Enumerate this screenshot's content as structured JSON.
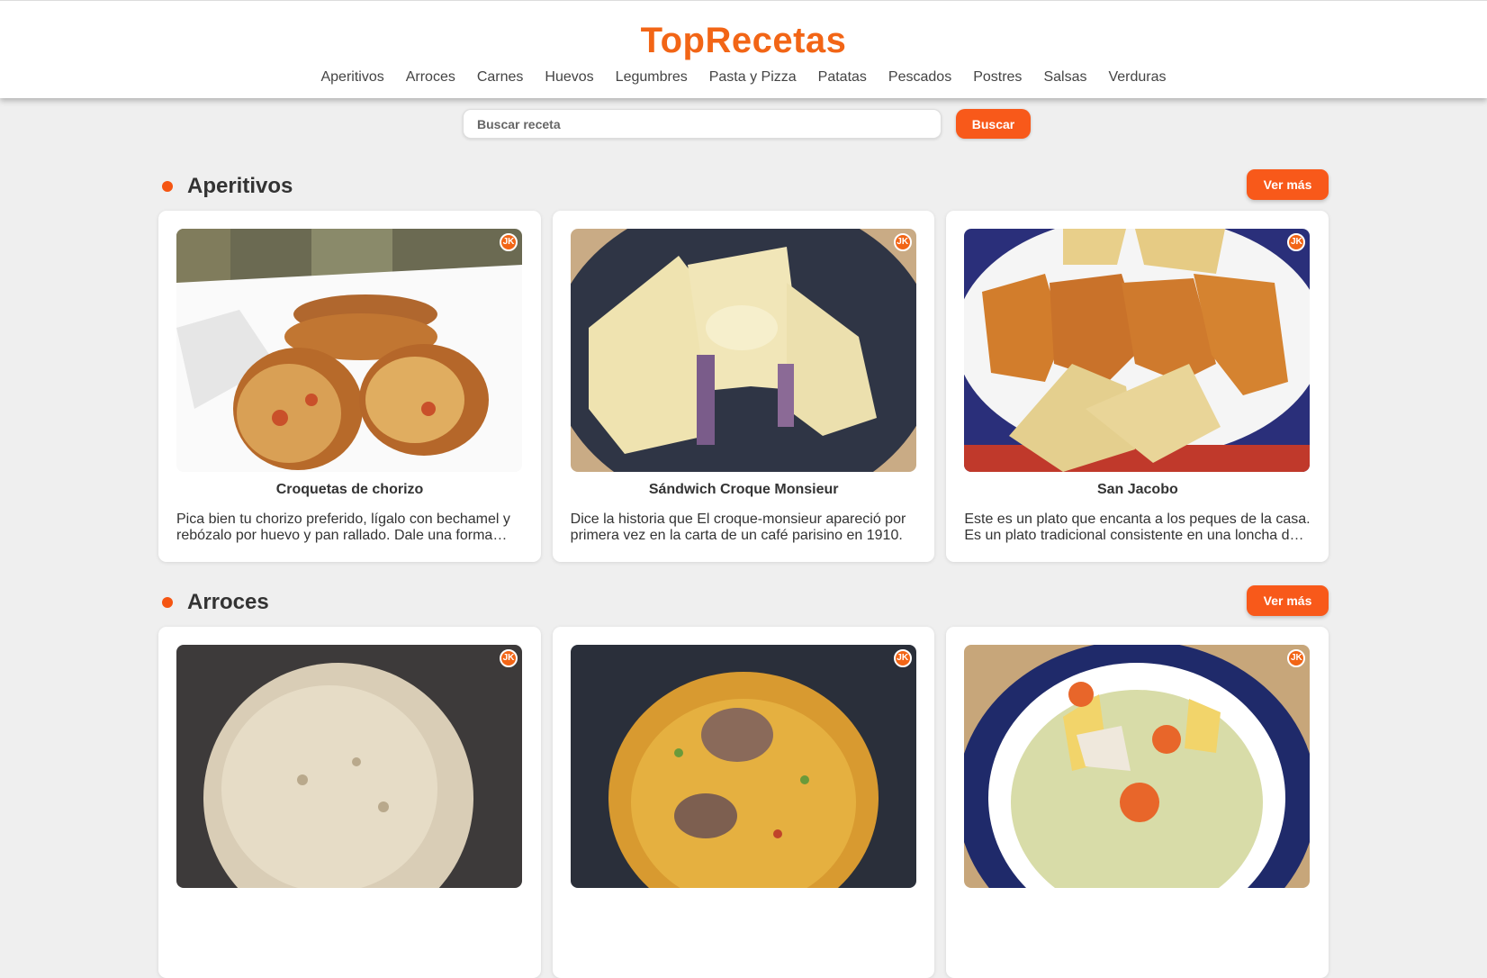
{
  "site": {
    "logo": "TopRecetas"
  },
  "nav": [
    "Aperitivos",
    "Arroces",
    "Carnes",
    "Huevos",
    "Legumbres",
    "Pasta y Pizza",
    "Patatas",
    "Pescados",
    "Postres",
    "Salsas",
    "Verduras"
  ],
  "search": {
    "placeholder": "Buscar receta",
    "button": "Buscar"
  },
  "sections": [
    {
      "title": "Aperitivos",
      "more": "Ver más",
      "cards": [
        {
          "title": "Croquetas de chorizo",
          "description": "Pica bien tu chorizo preferido, lígalo con bechamel y rebózalo por huevo y pan rallado. Dale una forma alargada y fríelas."
        },
        {
          "title": "Sándwich Croque Monsieur",
          "description": "Dice la historia que El croque-monsieur apareció por primera vez en la carta de un café parisino en 1910."
        },
        {
          "title": "San Jacobo",
          "description": "Este es un plato que encanta a los peques de la casa. Es un plato tradicional consistente en una loncha de jamón y queso."
        }
      ]
    },
    {
      "title": "Arroces",
      "more": "Ver más",
      "cards": [
        {
          "title": "",
          "description": ""
        },
        {
          "title": "",
          "description": ""
        },
        {
          "title": "",
          "description": ""
        }
      ]
    }
  ],
  "colors": {
    "accent": "#f8591a",
    "logo": "#f26516",
    "background": "#efefef"
  },
  "icons": {
    "card_badge": "chef-badge-icon",
    "section_marker": "dot-icon"
  }
}
